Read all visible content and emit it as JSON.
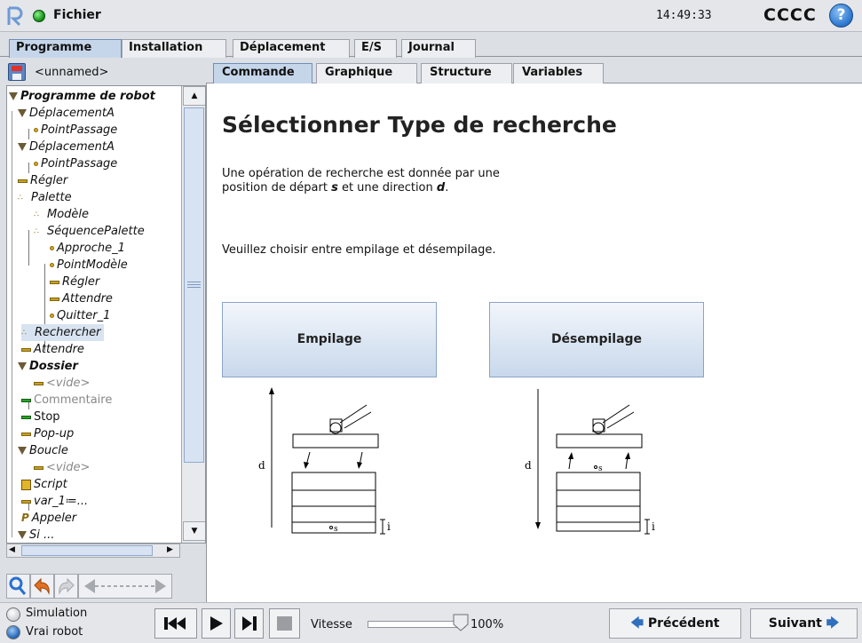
{
  "app": {
    "menu": "Fichier",
    "clock": "14:49:33",
    "user": "CCCC",
    "help": "?"
  },
  "top_tabs": [
    "Programme",
    "Installation",
    "Déplacement",
    "E/S",
    "Journal"
  ],
  "program": {
    "name": "<unnamed>"
  },
  "tree": [
    "Programme de robot",
    "DéplacementA",
    "PointPassage",
    "DéplacementA",
    "PointPassage",
    "Régler",
    "Palette",
    "Modèle",
    "SéquencePalette",
    "Approche_1",
    "PointModèle",
    "Régler",
    "Attendre",
    "Quitter_1",
    "Rechercher",
    "Attendre",
    "Dossier",
    "<vide>",
    "Commentaire",
    "Stop",
    "Pop-up",
    "Boucle",
    "<vide>",
    "Script",
    "var_1≔...",
    "Appeler",
    "Si ..."
  ],
  "sub_tabs": [
    "Commande",
    "Graphique",
    "Structure",
    "Variables"
  ],
  "main": {
    "title": "Sélectionner Type de recherche",
    "desc_line1": "Une opération de recherche est donnée par une",
    "desc_line2_pre": "position de départ ",
    "desc_s": "s",
    "desc_line2_mid": " et une direction ",
    "desc_d": "d",
    "desc_line2_end": ".",
    "prompt": "Veuillez choisir entre empilage et désempilage.",
    "stack_button": "Empilage",
    "unstack_button": "Désempilage",
    "diagram_d": "d",
    "diagram_s": "s",
    "diagram_i": "i"
  },
  "bottom": {
    "simulation": "Simulation",
    "real_robot": "Vrai robot",
    "speed_label": "Vitesse",
    "speed_value": "100%",
    "speed_fraction": 1.0,
    "prev": "Précédent",
    "next": "Suivant"
  },
  "colors": {
    "accent": "#c6d6ea",
    "button": "#c8d8ec",
    "status_green": "#1c9b1c",
    "help_blue": "#2f79d1",
    "tree_selection": "#d8e3f1"
  },
  "icons": [
    "ur-logo-icon",
    "status-dot-icon",
    "help-icon",
    "save-icon",
    "search-icon",
    "undo-icon",
    "redo-icon",
    "move-arrows-icon",
    "skip-back-icon",
    "play-icon",
    "step-forward-icon",
    "stop-icon",
    "arrow-left-icon",
    "arrow-right-icon"
  ]
}
